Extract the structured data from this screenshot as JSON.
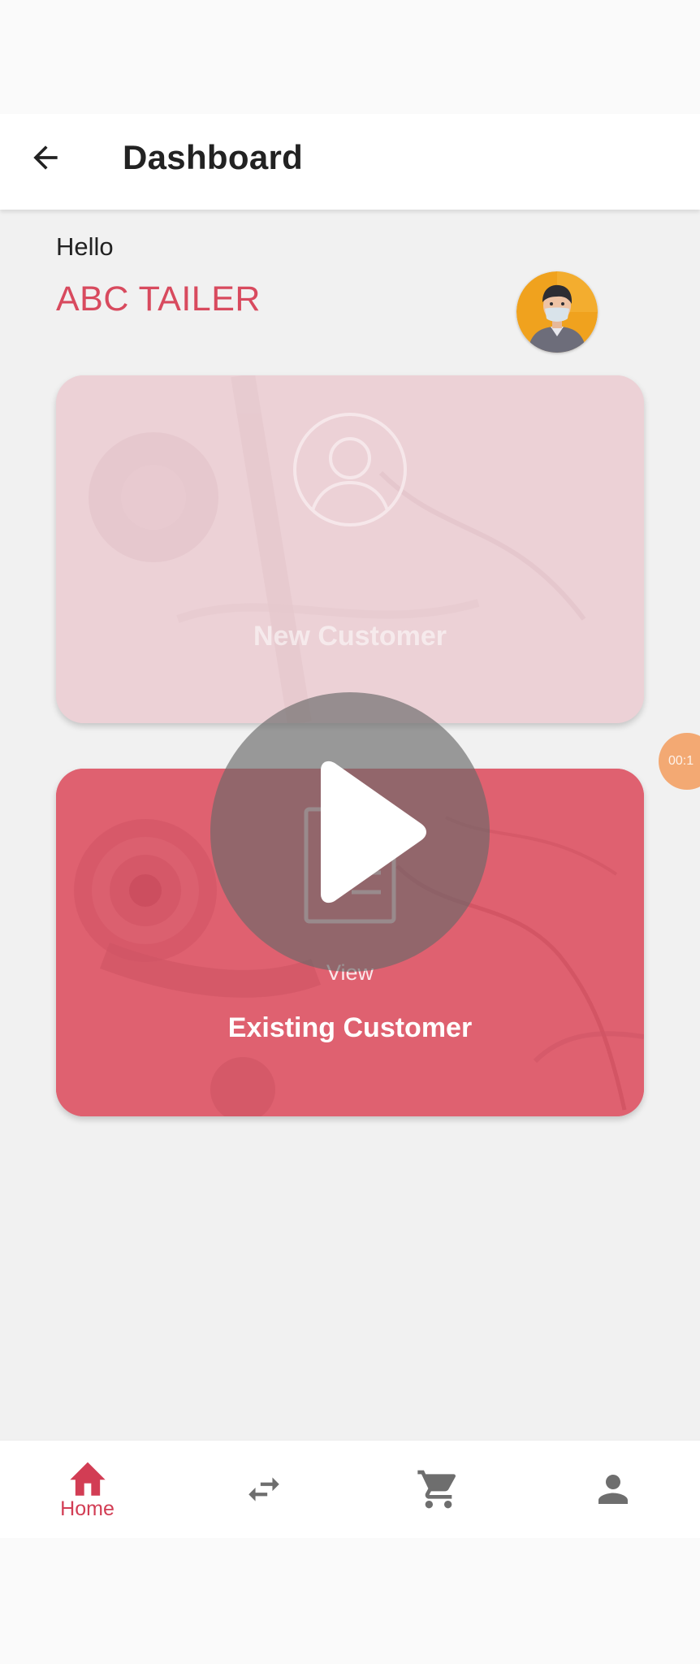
{
  "app_bar": {
    "title": "Dashboard",
    "back_icon": "arrow-left-icon"
  },
  "greeting": {
    "hello": "Hello",
    "shop_name": "ABC TAILER",
    "avatar_icon": "user-avatar-icon"
  },
  "cards": {
    "new_customer": {
      "label": "New Customer",
      "icon": "user-circle-icon"
    },
    "existing_customer": {
      "sub_label": "View",
      "label": "Existing Customer",
      "icon": "document-list-icon"
    }
  },
  "timer": {
    "text": "00:1"
  },
  "video_overlay": {
    "icon": "play-icon"
  },
  "bottom_nav": {
    "items": [
      {
        "label": "Home",
        "icon": "home-icon",
        "active": true
      },
      {
        "label": "",
        "icon": "swap-arrows-icon",
        "active": false
      },
      {
        "label": "",
        "icon": "cart-icon",
        "active": false
      },
      {
        "label": "",
        "icon": "person-icon",
        "active": false
      }
    ]
  },
  "colors": {
    "accent": "#d84a5e",
    "card_new": "#ecd1d6",
    "card_existing": "#df6170",
    "timer": "#f3a973"
  }
}
